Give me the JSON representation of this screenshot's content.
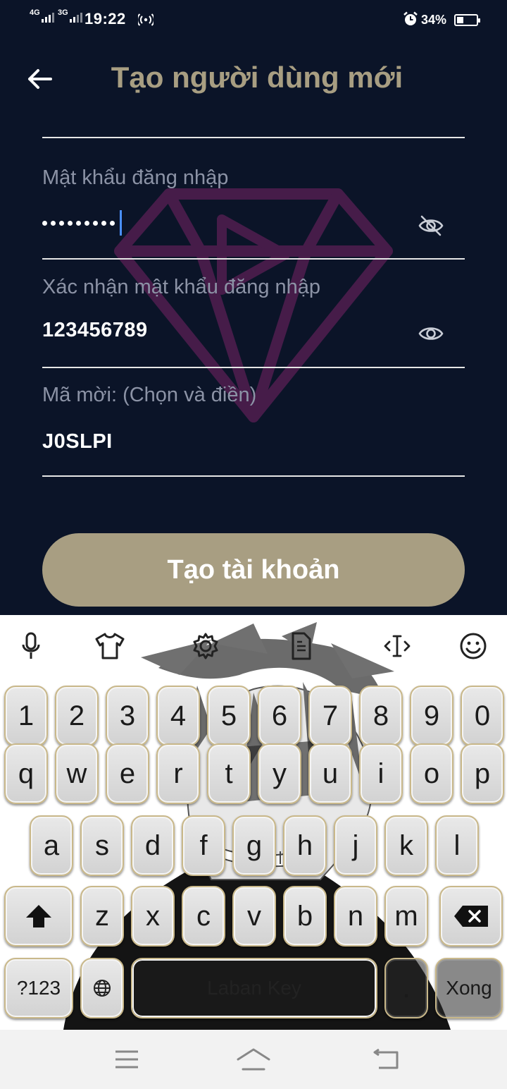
{
  "status_bar": {
    "network_1": "4G",
    "network_2": "3G",
    "time": "19:22",
    "battery_percent": "34%",
    "battery_level": 0.34
  },
  "header": {
    "title": "Tạo người  dùng mới"
  },
  "form": {
    "password": {
      "label": "Mật khẩu đăng nhập",
      "masked_length": 9
    },
    "confirm_password": {
      "label": "Xác nhận mật khẩu đăng nhập",
      "value": "123456789"
    },
    "invite_code": {
      "label": "Mã mời: (Chọn và điền)",
      "value": "J0SLPI"
    },
    "submit_label": "Tạo tài khoản"
  },
  "keyboard": {
    "toolbar": [
      "microphone-icon",
      "theme-shirt-icon",
      "settings-gear-icon",
      "clipboard-icon",
      "cursor-move-icon",
      "emoji-icon"
    ],
    "row_numbers": [
      "1",
      "2",
      "3",
      "4",
      "5",
      "6",
      "7",
      "8",
      "9",
      "0"
    ],
    "row_1": [
      "q",
      "w",
      "e",
      "r",
      "t",
      "y",
      "u",
      "i",
      "o",
      "p"
    ],
    "row_2": [
      "a",
      "s",
      "d",
      "f",
      "g",
      "h",
      "j",
      "k",
      "l"
    ],
    "row_3": [
      "z",
      "x",
      "c",
      "v",
      "b",
      "n",
      "m"
    ],
    "symbols_label": "?123",
    "space_label": "Laban Key",
    "period_label": ".",
    "done_label": "Xong"
  },
  "colors": {
    "background": "#0b1428",
    "accent": "#a89e82",
    "label": "#8c93a6",
    "cursor": "#4a90ff"
  }
}
